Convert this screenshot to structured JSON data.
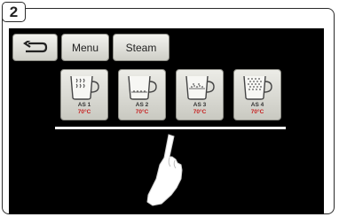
{
  "step": {
    "number": "2"
  },
  "toolbar": {
    "menu_label": "Menu",
    "steam_label": "Steam"
  },
  "cups": [
    {
      "label": "AS 1",
      "temp": "70°C",
      "icon": "cup-steam-icon"
    },
    {
      "label": "AS 2",
      "temp": "70°C",
      "icon": "cup-foam-icon"
    },
    {
      "label": "AS 3",
      "temp": "70°C",
      "icon": "cup-milk-foam-icon"
    },
    {
      "label": "AS 4",
      "temp": "70°C",
      "icon": "cup-full-foam-icon"
    }
  ],
  "colors": {
    "screen": "#000000",
    "temperature": "#c62020",
    "button": "#dcdcd6"
  }
}
